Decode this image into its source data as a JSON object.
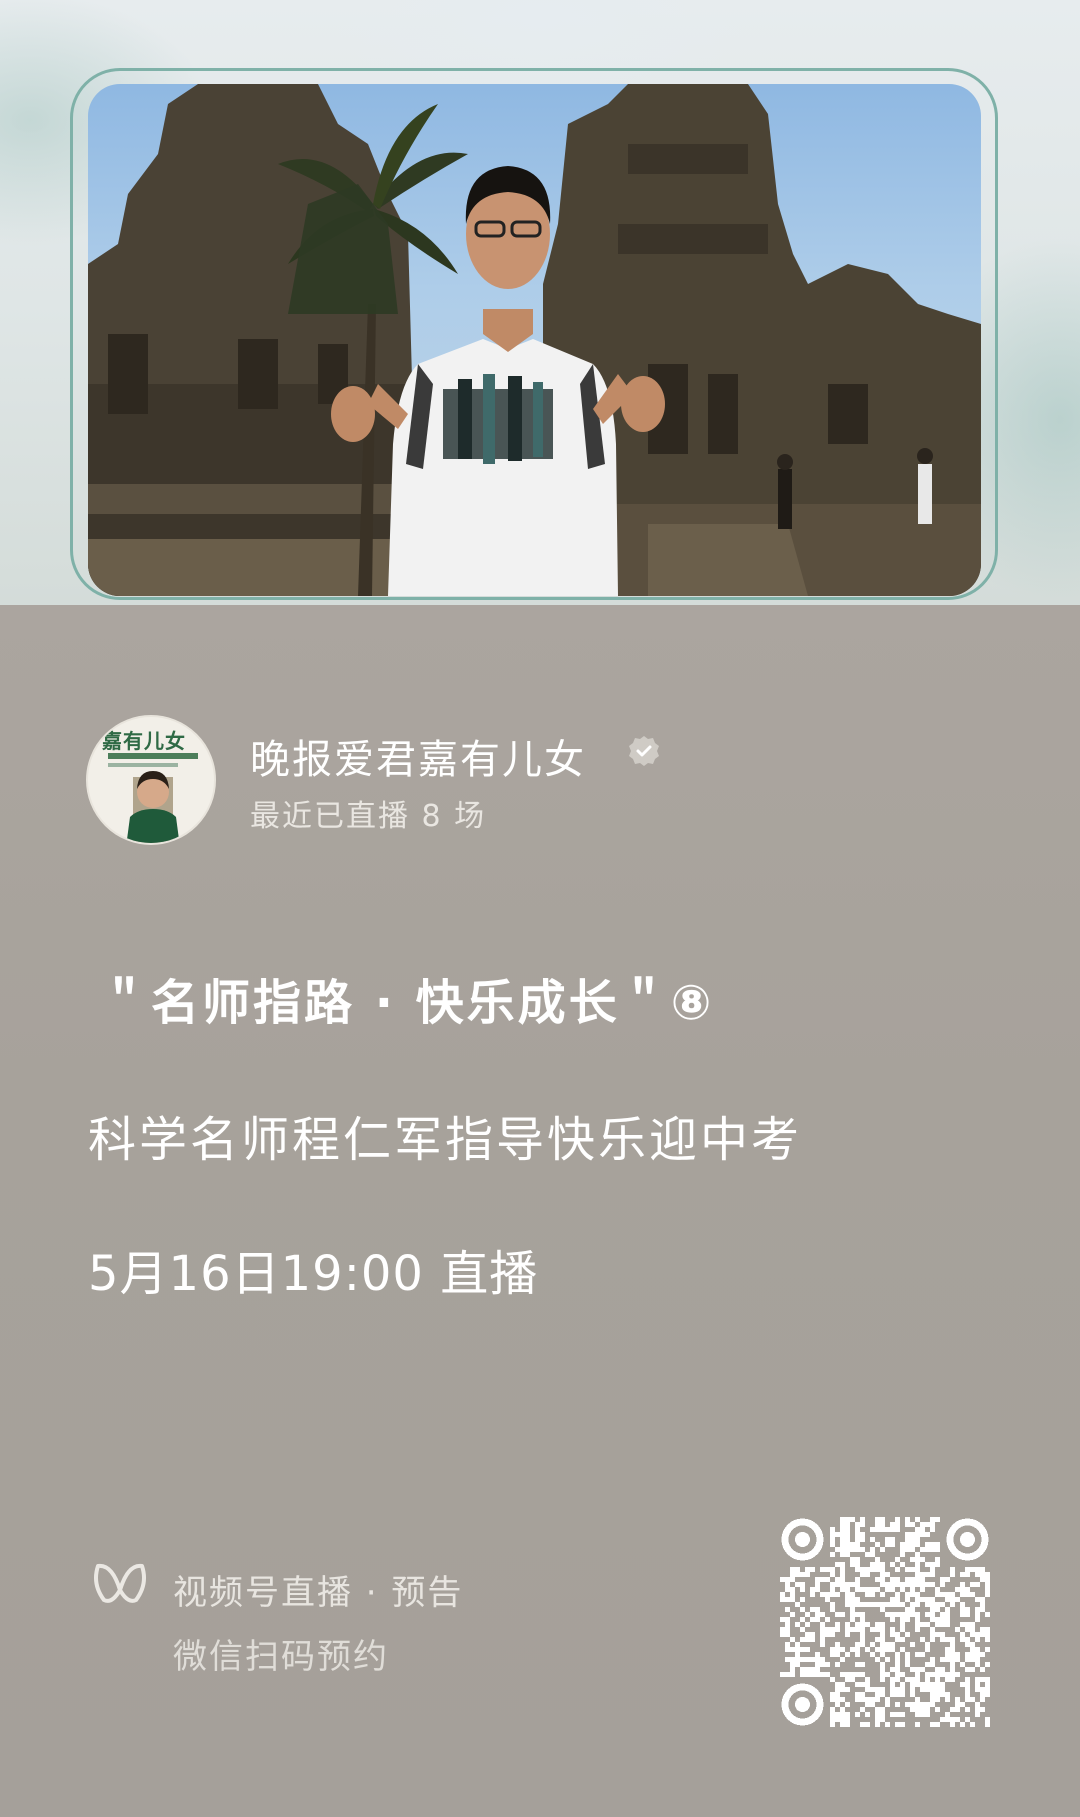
{
  "account": {
    "name": "晚报爱君嘉有儿女",
    "recent_streams": "最近已直播 8 场",
    "avatar_text": "嘉有儿女"
  },
  "event": {
    "title": "＂名师指路 · 快乐成长＂⑧",
    "subtitle": "科学名师程仁军指导快乐迎中考",
    "time": "5月16日19:00 直播"
  },
  "footer": {
    "line1": "视频号直播 · 预告",
    "line2": "微信扫码预约",
    "icon": "channels-icon"
  },
  "colors": {
    "frame_border": "#7fb1a8",
    "panel_bg": "#a9a49d",
    "text_primary": "#ffffff"
  }
}
